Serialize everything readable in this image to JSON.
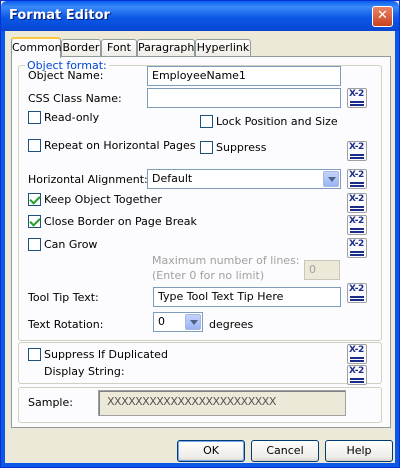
{
  "window": {
    "title": "Format Editor",
    "close_label": "✕"
  },
  "tabs": [
    {
      "label": "Common"
    },
    {
      "label": "Border"
    },
    {
      "label": "Font"
    },
    {
      "label": "Paragraph"
    },
    {
      "label": "Hyperlink"
    }
  ],
  "object_format": {
    "legend": "Object format:",
    "object_name_label": "Object Name:",
    "object_name_value": "EmployeeName1",
    "css_class_label": "CSS Class Name:",
    "css_class_value": "",
    "read_only_label": "Read-only",
    "read_only_checked": false,
    "lock_position_label": "Lock Position and Size",
    "lock_position_checked": false,
    "repeat_label": "Repeat on Horizontal Pages",
    "repeat_checked": false,
    "suppress_label": "Suppress",
    "suppress_checked": false,
    "horizontal_alignment_label": "Horizontal Alignment:",
    "horizontal_alignment_value": "Default",
    "keep_together_label": "Keep Object Together",
    "keep_together_checked": true,
    "close_border_label": "Close Border on Page Break",
    "close_border_checked": true,
    "can_grow_label": "Can Grow",
    "can_grow_checked": false,
    "max_lines_label": "Maximum number of lines:",
    "max_lines_hint": "(Enter 0 for no limit)",
    "max_lines_value": "0",
    "tooltip_label": "Tool Tip Text:",
    "tooltip_value": "Type Tool Text Tip Here",
    "rotation_label": "Text Rotation:",
    "rotation_value": "0",
    "rotation_unit": "degrees"
  },
  "suppress_group": {
    "suppress_dup_label": "Suppress If Duplicated",
    "suppress_dup_checked": false,
    "display_string_label": "Display String:"
  },
  "sample": {
    "label": "Sample:",
    "value": "XXXXXXXXXXXXXXXXXXXXXXXX"
  },
  "formula_button": {
    "glyph": "X-2"
  },
  "buttons": {
    "ok": "OK",
    "cancel": "Cancel",
    "help": "Help"
  }
}
